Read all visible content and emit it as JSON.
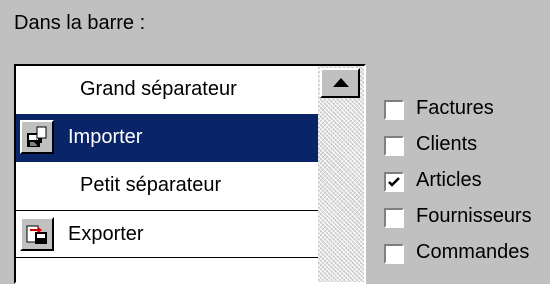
{
  "section_label": "Dans la barre :",
  "list": {
    "items": [
      {
        "label": "Grand séparateur",
        "icon": null,
        "selected": false
      },
      {
        "label": "Importer",
        "icon": "import-icon",
        "selected": true
      },
      {
        "label": "Petit séparateur",
        "icon": null,
        "selected": false
      },
      {
        "label": "Exporter",
        "icon": "export-icon",
        "selected": false
      }
    ],
    "scroll_up_icon": "scroll-up-arrow-icon"
  },
  "checkboxes": [
    {
      "label": "Factures",
      "checked": false
    },
    {
      "label": "Clients",
      "checked": false
    },
    {
      "label": "Articles",
      "checked": true
    },
    {
      "label": "Fournisseurs",
      "checked": false
    },
    {
      "label": "Commandes",
      "checked": false
    }
  ],
  "colors": {
    "window_bg": "#c0c0c0",
    "selection_bg": "#0a2468",
    "selection_text": "#ffffff"
  }
}
